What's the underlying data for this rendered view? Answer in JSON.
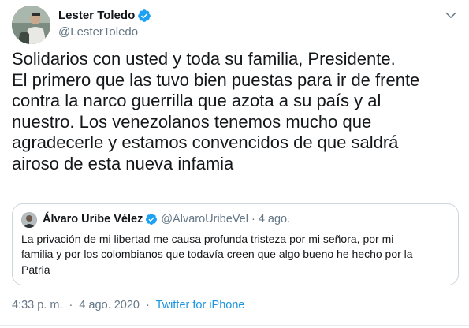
{
  "author": {
    "display_name": "Lester Toledo",
    "handle": "@LesterToledo",
    "verified": true,
    "avatar_icon": "profile-photo-icon"
  },
  "tweet": {
    "text_lines": [
      "Solidarios con usted y toda su familia, Presidente.",
      "El primero que las tuvo bien puestas para ir de frente",
      "contra la narco guerrilla que azota a su país y al",
      "nuestro. Los venezolanos tenemos mucho que",
      "agradecerle y estamos convencidos de que saldrá",
      "airoso de esta nueva infamia"
    ]
  },
  "quoted_tweet": {
    "display_name": "Álvaro Uribe Vélez",
    "handle": "@AlvaroUribeVel",
    "separator": "·",
    "time": "4 ago.",
    "verified": true,
    "text_lines": [
      "La privación de mi libertad me causa profunda tristeza por mi señora, por mi",
      "familia y por los colombianos que todavía creen que algo bueno he hecho por la",
      "Patria"
    ]
  },
  "meta": {
    "time": "4:33 p. m.",
    "separator": "·",
    "date": "4 ago. 2020",
    "separator2": "·",
    "source": "Twitter for iPhone"
  },
  "colors": {
    "accent": "#1da1f2",
    "link": "#1b95e0",
    "secondary_text": "#657786",
    "border": "#ccd6dd"
  }
}
